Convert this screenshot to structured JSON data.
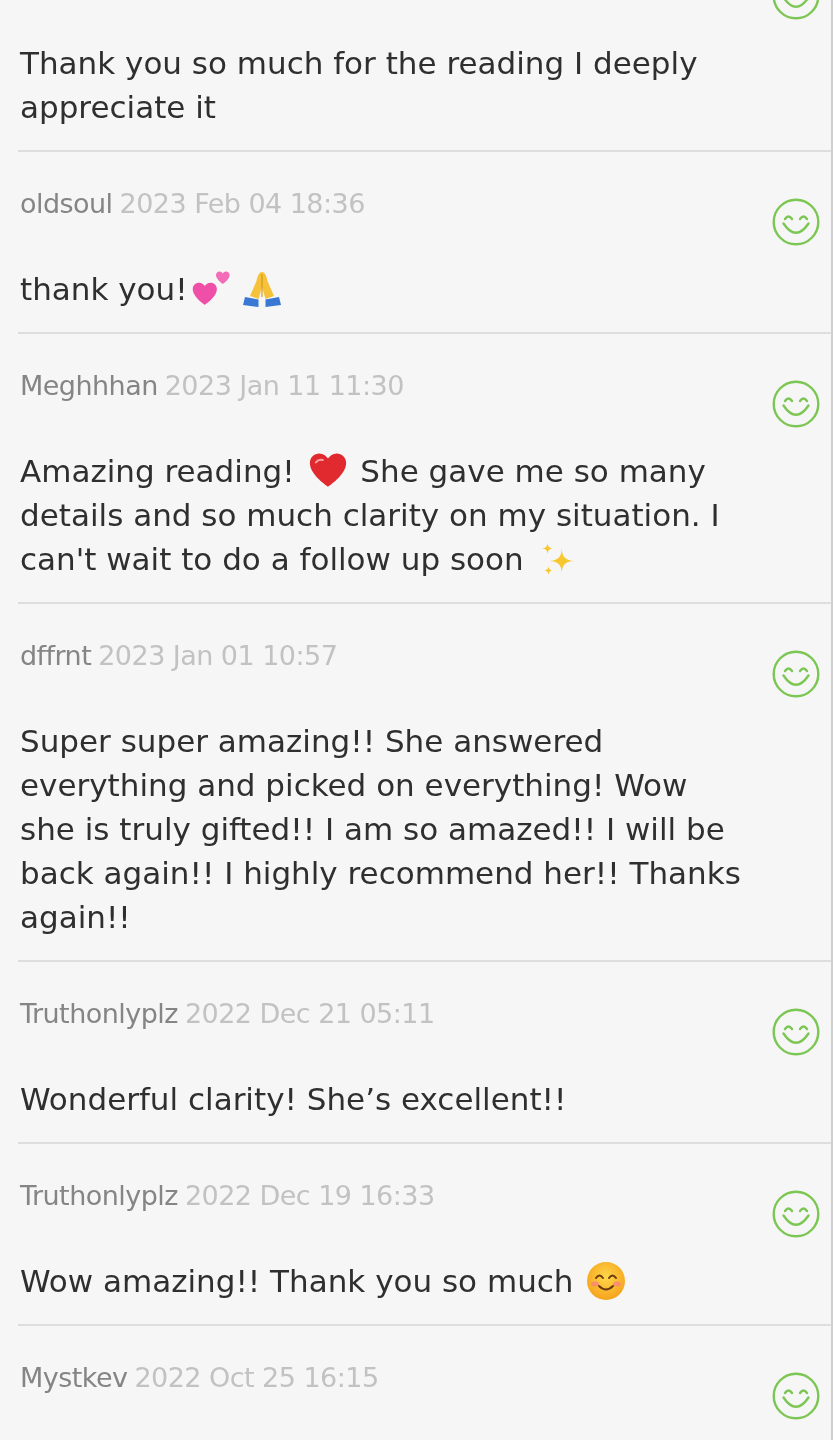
{
  "reviews": [
    {
      "body": [
        {
          "kind": "text",
          "text": "Thank you so much for the reading I deeply appreciate it"
        }
      ]
    },
    {
      "username": "oldsoul",
      "date": "2023 Feb 04 18:36",
      "body": [
        {
          "kind": "text",
          "text": "thank you!"
        },
        {
          "kind": "hearts"
        },
        {
          "kind": "pray"
        }
      ]
    },
    {
      "username": "Meghhhan",
      "date": "2023 Jan 11 11:30",
      "body": [
        {
          "kind": "text",
          "text": "Amazing reading! "
        },
        {
          "kind": "heart"
        },
        {
          "kind": "text",
          "text": " She gave me so many "
        },
        {
          "kind": "text",
          "text": "details and so much clarity on my situation. I "
        },
        {
          "kind": "text",
          "text": "can't wait to do a follow up soon "
        },
        {
          "kind": "sparkles"
        }
      ]
    },
    {
      "username": "dffrnt",
      "date": "2023 Jan 01 10:57",
      "body": [
        {
          "kind": "text",
          "text": "Super super amazing!! She answered everything and picked on everything! Wow she is truly gifted!! I am so amazed!! I will be back again!! I highly recommend her!! Thanks again!!"
        }
      ]
    },
    {
      "username": "Truthonlyplz",
      "date": "2022 Dec 21 05:11",
      "body": [
        {
          "kind": "text",
          "text": "Wonderful clarity! She’s excellent!!"
        }
      ]
    },
    {
      "username": "Truthonlyplz",
      "date": "2022 Dec 19 16:33",
      "body": [
        {
          "kind": "text",
          "text": "Wow amazing!! Thank you so much "
        },
        {
          "kind": "smile"
        }
      ]
    },
    {
      "username": "Mystkev",
      "date": "2022 Oct 25 16:15"
    }
  ]
}
